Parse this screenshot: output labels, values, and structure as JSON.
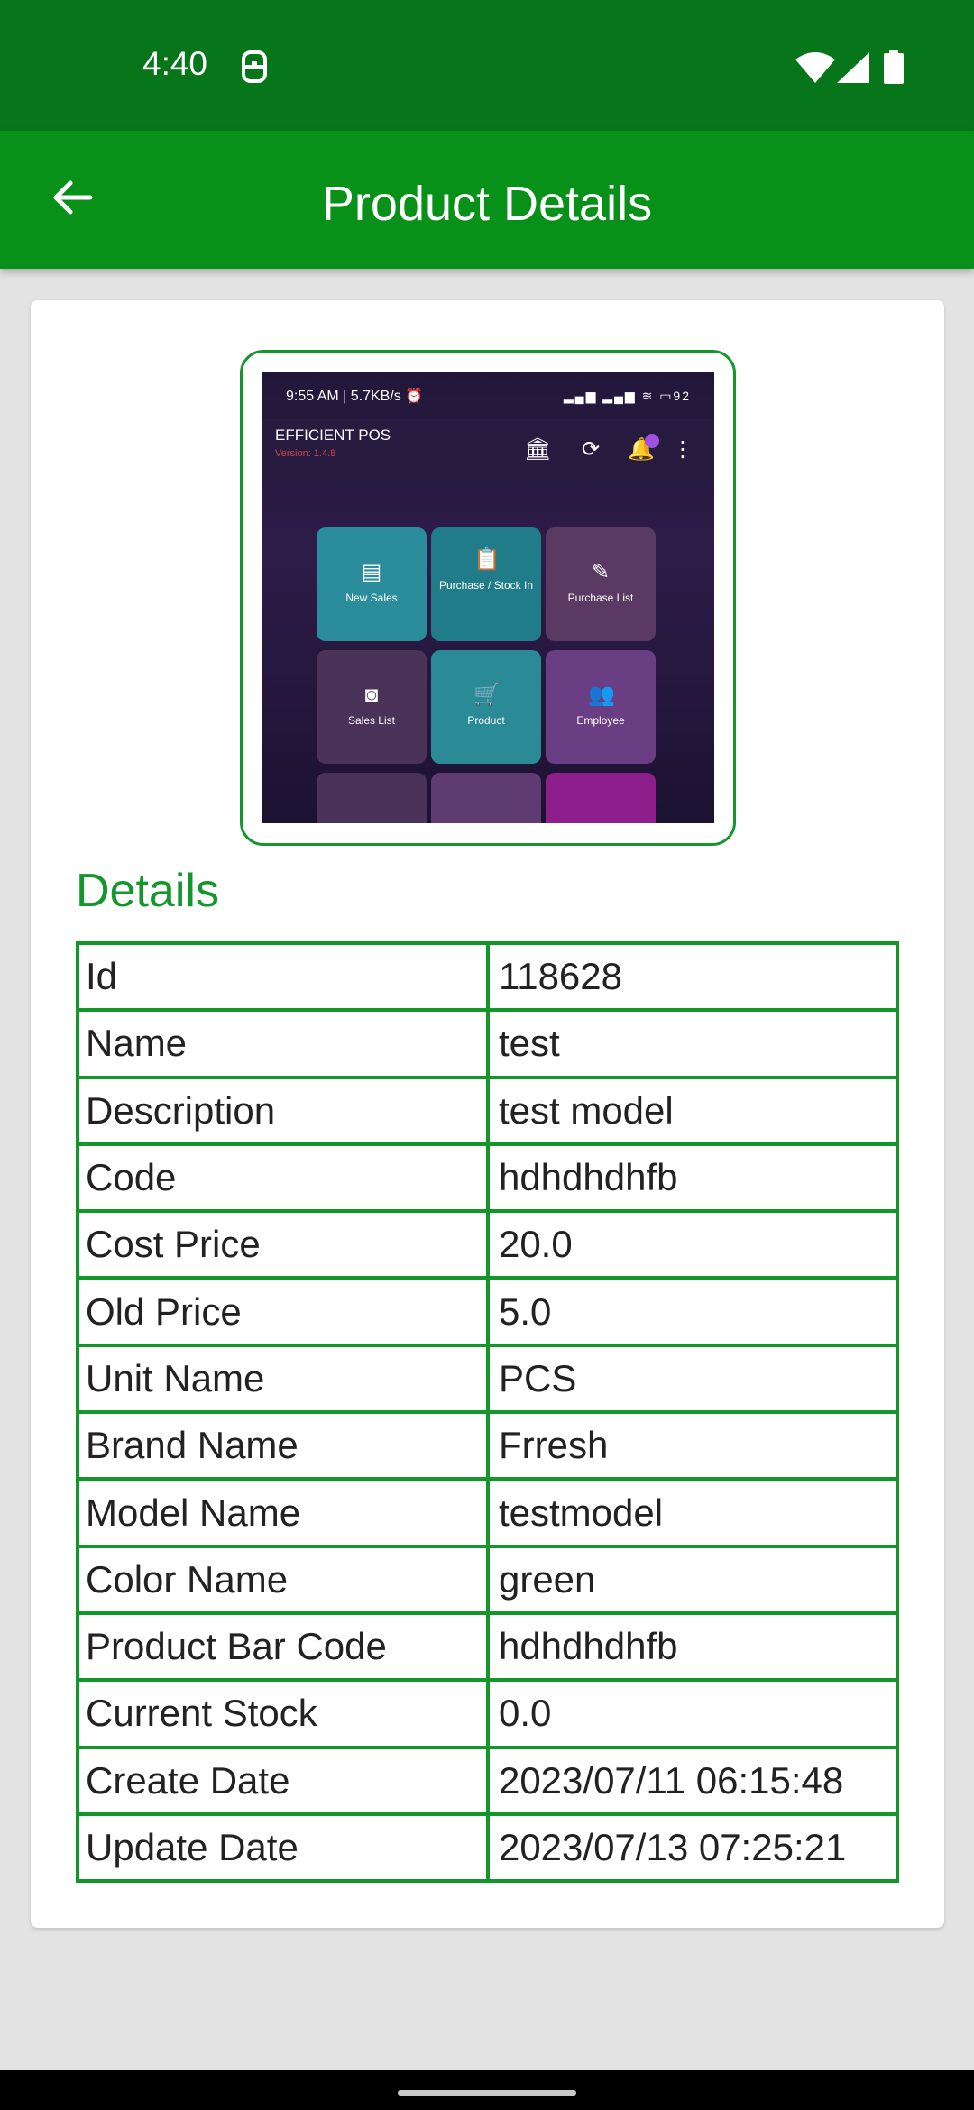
{
  "status_bar": {
    "time": "4:40",
    "icons": [
      "lock-icon",
      "wifi-icon",
      "signal-icon",
      "battery-icon"
    ],
    "color": "#07761a"
  },
  "app_bar": {
    "title": "Product Details",
    "back_icon": "arrow-left-icon",
    "color": "#079118"
  },
  "product_image": {
    "status_text": "9:55 AM | 5.7KB/s ⏰",
    "battery_text": "92",
    "app_title": "EFFICIENT POS",
    "version": "Version: 1.4.8",
    "tiles": [
      {
        "label": "New Sales",
        "icon": "receipt-icon"
      },
      {
        "label": "Purchase / Stock In",
        "icon": "clipboard-icon"
      },
      {
        "label": "Purchase List",
        "icon": "list-icon"
      },
      {
        "label": "Sales List",
        "icon": "box-icon"
      },
      {
        "label": "Product",
        "icon": "cart-icon"
      },
      {
        "label": "Employee",
        "icon": "people-icon"
      }
    ]
  },
  "details": {
    "title": "Details",
    "accent": "#13962a",
    "rows": [
      {
        "label": "Id",
        "value": "118628"
      },
      {
        "label": "Name",
        "value": "test"
      },
      {
        "label": "Description",
        "value": "test model"
      },
      {
        "label": "Code",
        "value": "hdhdhdhfb"
      },
      {
        "label": "Cost Price",
        "value": "20.0"
      },
      {
        "label": "Old Price",
        "value": "5.0"
      },
      {
        "label": "Unit Name",
        "value": "PCS"
      },
      {
        "label": "Brand Name",
        "value": "Frresh"
      },
      {
        "label": "Model Name",
        "value": "testmodel"
      },
      {
        "label": "Color Name",
        "value": "green"
      },
      {
        "label": "Product Bar Code",
        "value": "hdhdhdhfb"
      },
      {
        "label": "Current Stock",
        "value": "0.0"
      },
      {
        "label": "Create Date",
        "value": "2023/07/11 06:15:48"
      },
      {
        "label": "Update Date",
        "value": "2023/07/13 07:25:21"
      }
    ]
  }
}
